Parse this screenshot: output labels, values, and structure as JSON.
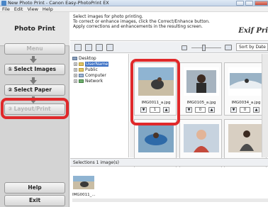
{
  "window": {
    "title": "New Photo Print - Canon Easy-PhotoPrint EX"
  },
  "menu": [
    "File",
    "Edit",
    "View",
    "Help"
  ],
  "sidebar": {
    "title": "Photo Print",
    "menu_label": "Menu",
    "steps": [
      {
        "number": "①",
        "label": "Select Images",
        "state": "active"
      },
      {
        "number": "②",
        "label": "Select Paper",
        "state": "normal"
      },
      {
        "number": "③",
        "label": "Layout/Print",
        "state": "disabled"
      }
    ],
    "help_label": "Help",
    "exit_label": "Exit"
  },
  "instructions": [
    "Select images for photo printing.",
    "To correct or enhance images, click the Correct/Enhance button.",
    "Apply corrections and enhancements in the resulting screen."
  ],
  "logo_text": "Exif Pri",
  "toolbar": {
    "sort_label": "Sort by Date"
  },
  "tree": [
    "Desktop",
    "UserName",
    "Public",
    "Computer",
    "Network"
  ],
  "thumbnails": [
    {
      "file": "IMG0011_a.jpg",
      "copies": "1",
      "selected": true,
      "icon": "photo-beach-icon"
    },
    {
      "file": "IMG0105_a.jpg",
      "copies": "0",
      "selected": false,
      "icon": "photo-woman-icon"
    },
    {
      "file": "IMG0034_a.jpg",
      "copies": "0",
      "selected": false,
      "icon": "photo-surf-icon"
    },
    {
      "file": "",
      "copies": "",
      "selected": false,
      "icon": "photo-float-icon"
    },
    {
      "file": "",
      "copies": "",
      "selected": false,
      "icon": "photo-girl-icon"
    },
    {
      "file": "",
      "copies": "",
      "selected": false,
      "icon": "photo-sit-icon"
    }
  ],
  "selections": {
    "header": "Selections 1 image(s)",
    "file": "IMG0011_..."
  },
  "colors": {
    "highlight_ring": "#e0282a",
    "selection": "#3a6fc4"
  }
}
